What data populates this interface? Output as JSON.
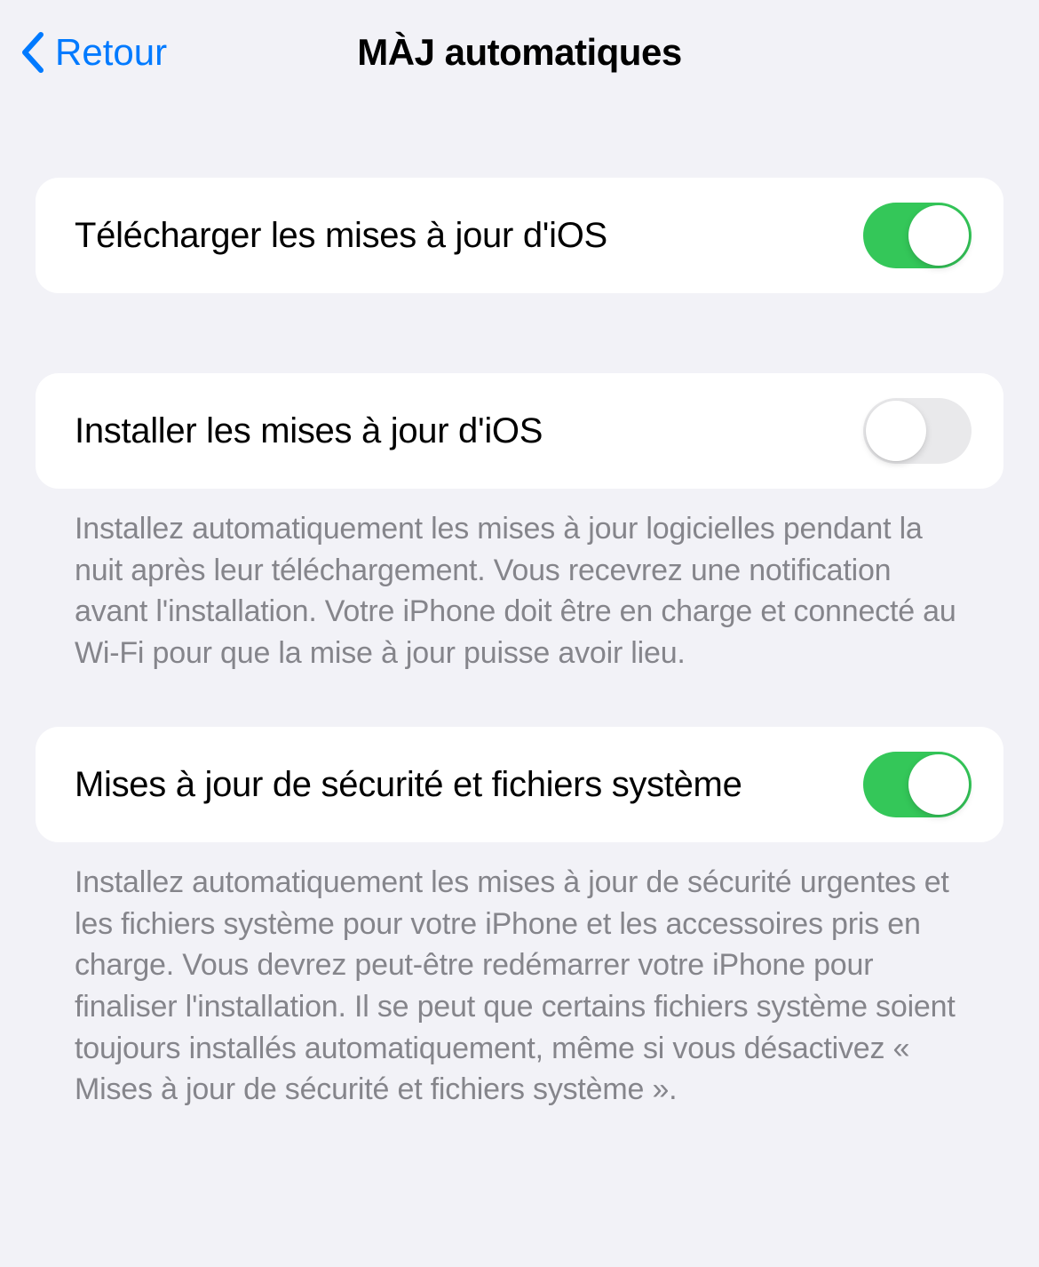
{
  "nav": {
    "back_label": "Retour",
    "title": "MÀJ automatiques"
  },
  "sections": {
    "download": {
      "label": "Télécharger les mises à jour d'iOS",
      "enabled": true
    },
    "install": {
      "label": "Installer les mises à jour d'iOS",
      "enabled": false,
      "footer": "Installez automatiquement les mises à jour logicielles pendant la nuit après leur téléchargement. Vous recevrez une notification avant l'installation. Votre iPhone doit être en charge et connecté au Wi-Fi pour que la mise à jour puisse avoir lieu."
    },
    "security": {
      "label": "Mises à jour de sécurité et fichiers système",
      "enabled": true,
      "footer": "Installez automatiquement les mises à jour de sécurité urgentes et les fichiers système pour votre iPhone et les accessoires pris en charge. Vous devrez peut-être redémarrer votre iPhone pour finaliser l'installation. Il se peut que certains fichiers système soient toujours installés automatiquement, même si vous désactivez « Mises à jour de sécurité et fichiers système »."
    }
  }
}
